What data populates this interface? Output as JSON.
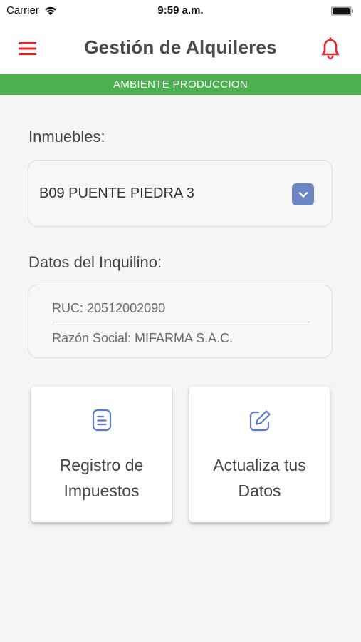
{
  "status_bar": {
    "carrier": "Carrier",
    "time": "9:59 a.m."
  },
  "header": {
    "title": "Gestión de Alquileres",
    "accent_color": "#e8232a"
  },
  "environment_banner": {
    "text": "AMBIENTE PRODUCCION",
    "color": "#4caf50"
  },
  "inmuebles": {
    "label": "Inmuebles:",
    "selected": "B09 PUENTE PIEDRA 3"
  },
  "inquilino": {
    "label": "Datos del Inquilino:",
    "ruc": "RUC: 20512002090",
    "razon_social": "Razón Social: MIFARMA S.A.C."
  },
  "actions": [
    {
      "label": "Registro de Impuestos",
      "icon": "document-icon"
    },
    {
      "label": "Actualiza tus Datos",
      "icon": "edit-icon"
    }
  ]
}
